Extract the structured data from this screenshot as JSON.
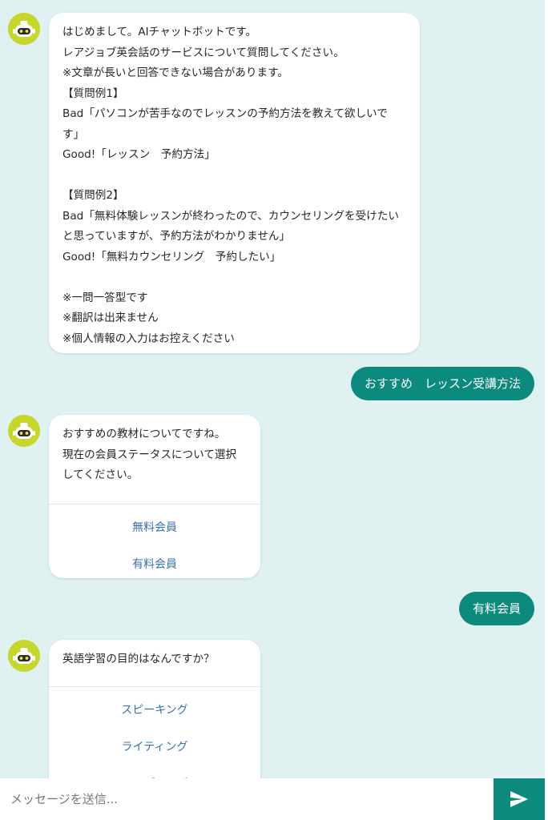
{
  "messages": [
    {
      "from": "bot",
      "text": "はじめまして。AIチャットボットです。\nレアジョブ英会話のサービスについて質問してください。\n※文章が長いと回答できない場合があります。\n【質問例1】\nBad「パソコンが苦手なのでレッスンの予約方法を教えて欲しいです」\nGood!「レッスン　予約方法」\n\n【質問例2】\nBad「無料体験レッスンが終わったので、カウンセリングを受けたいと思っていますが、予約方法がわかりません」\nGood!「無料カウンセリング　予約したい」\n\n※一問一答型です\n※翻訳は出来ません\n※個人情報の入力はお控えください"
    },
    {
      "from": "user",
      "text": "おすすめ　レッスン受講方法"
    },
    {
      "from": "bot",
      "text": "おすすめの教材についてですね。\n現在の会員ステータスについて選択してください。",
      "choices": [
        "無料会員",
        "有料会員"
      ]
    },
    {
      "from": "user",
      "text": "有料会員"
    },
    {
      "from": "bot",
      "text": "英語学習の目的はなんですか？",
      "choices": [
        "スピーキング",
        "ライティング",
        "リーディング"
      ]
    }
  ],
  "input": {
    "placeholder": "メッセージを送信..."
  },
  "icons": {
    "avatar": "robot-icon",
    "send": "paper-plane-icon"
  },
  "colors": {
    "chat_background": "#dff2f1",
    "user_bubble": "#0d8a7e",
    "send_button": "#0d8a7e",
    "avatar_background": "#c6d62a",
    "choice_text": "#3a70b0"
  }
}
